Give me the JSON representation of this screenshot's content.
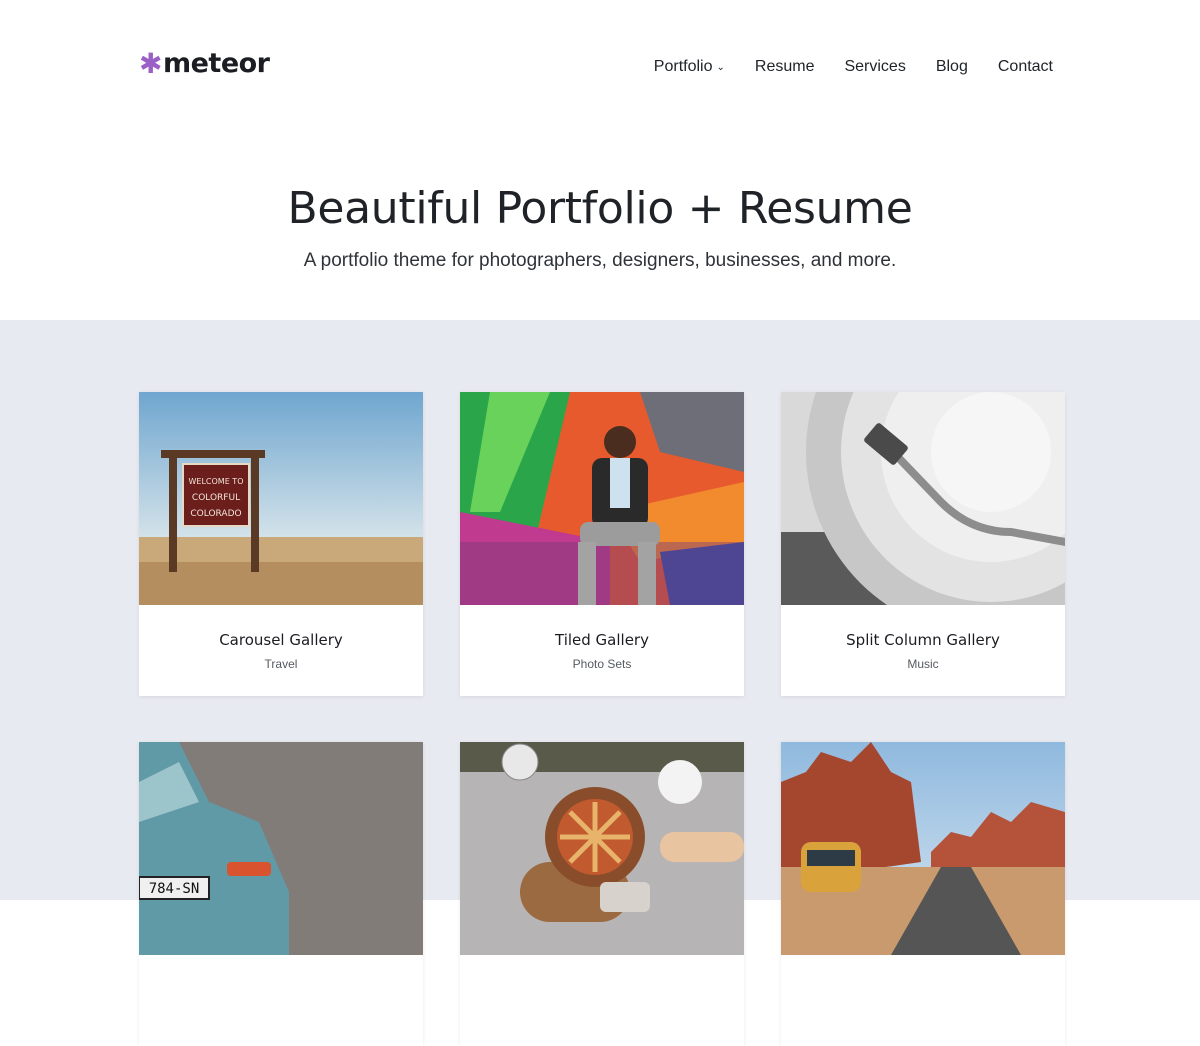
{
  "brand": {
    "logo_text": "meteor",
    "logo_icon": "asterisk-icon",
    "accent_color": "#9b5fc8"
  },
  "nav": {
    "items": [
      {
        "label": "Portfolio",
        "has_dropdown": true
      },
      {
        "label": "Resume"
      },
      {
        "label": "Services"
      },
      {
        "label": "Blog"
      },
      {
        "label": "Contact"
      }
    ]
  },
  "hero": {
    "title": "Beautiful Portfolio + Resume",
    "subtitle": "A portfolio theme for photographers, designers, businesses, and more."
  },
  "portfolio": {
    "items": [
      {
        "title": "Carousel Gallery",
        "category": "Travel"
      },
      {
        "title": "Tiled Gallery",
        "category": "Photo Sets"
      },
      {
        "title": "Split Column Gallery",
        "category": "Music"
      },
      {
        "title": "",
        "category": ""
      },
      {
        "title": "",
        "category": ""
      },
      {
        "title": "",
        "category": ""
      }
    ],
    "sign_text": [
      "WELCOME TO",
      "COLORFUL",
      "COLORADO"
    ],
    "plate_text": "784-SN"
  },
  "colors": {
    "page_bg": "#ffffff",
    "section_bg": "#e8eaf1"
  }
}
